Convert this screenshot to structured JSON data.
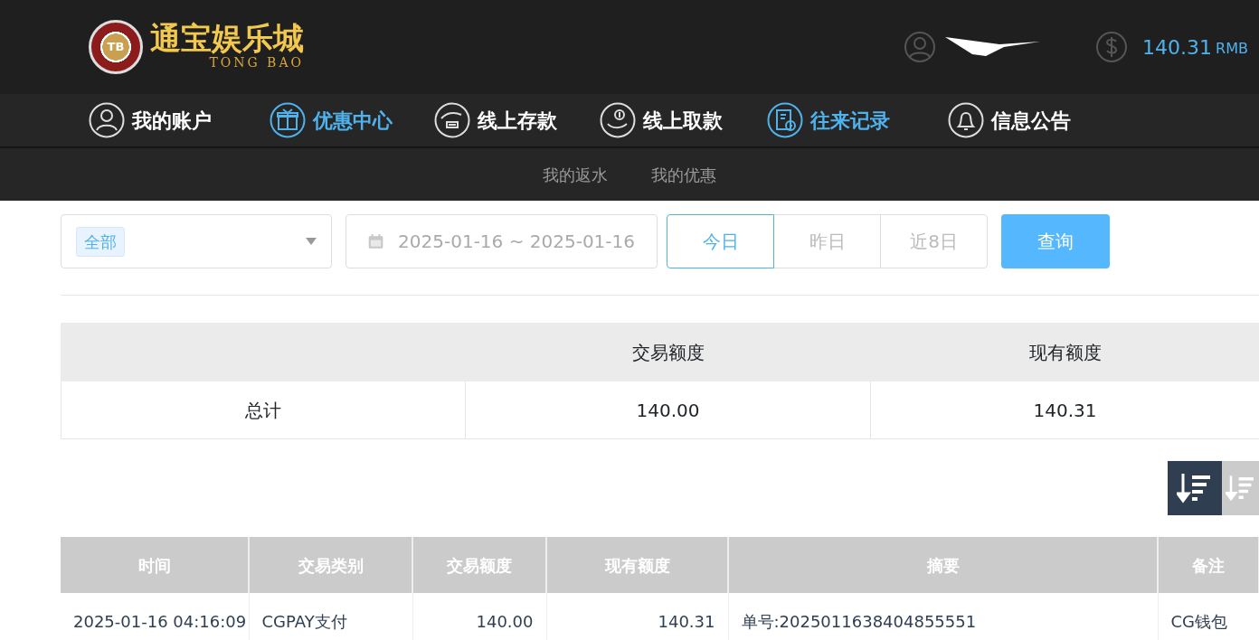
{
  "logo": {
    "chip": "TB",
    "name": "通宝娱乐城",
    "latin": "TONG BAO"
  },
  "balance": {
    "amount": "140.31",
    "currency": "RMB"
  },
  "nav": [
    {
      "label": "我的账户",
      "kind": "user",
      "selected": false
    },
    {
      "label": "优惠中心",
      "kind": "gift",
      "selected": true
    },
    {
      "label": "线上存款",
      "kind": "deposit",
      "selected": false
    },
    {
      "label": "线上取款",
      "kind": "withdraw",
      "selected": false
    },
    {
      "label": "往来记录",
      "kind": "record",
      "selected": true
    },
    {
      "label": "信息公告",
      "kind": "bell",
      "selected": false
    }
  ],
  "subnav": [
    {
      "label": "我的返水",
      "selected": false
    },
    {
      "label": "我的优惠",
      "selected": false
    }
  ],
  "filter": {
    "type_tag": "全部",
    "date_range": "2025-01-16 ~ 2025-01-16",
    "ranges": [
      {
        "label": "今日",
        "selected": true
      },
      {
        "label": "昨日",
        "selected": false
      },
      {
        "label": "近8日",
        "selected": false
      }
    ],
    "query": "查询"
  },
  "summary": {
    "columns": [
      "交易额度",
      "现有额度"
    ],
    "row": [
      "总计",
      "140.00",
      "140.31"
    ]
  },
  "sort": [
    {
      "selected": true
    },
    {
      "selected": false
    }
  ],
  "table": {
    "columns": [
      "时间",
      "交易类别",
      "交易额度",
      "现有额度",
      "摘要",
      "备注"
    ],
    "rows": [
      [
        "2025-01-16 04:16:09",
        "CGPAY支付",
        "140.00",
        "140.31",
        "单号:2025011638404855551",
        "CG钱包"
      ]
    ]
  }
}
